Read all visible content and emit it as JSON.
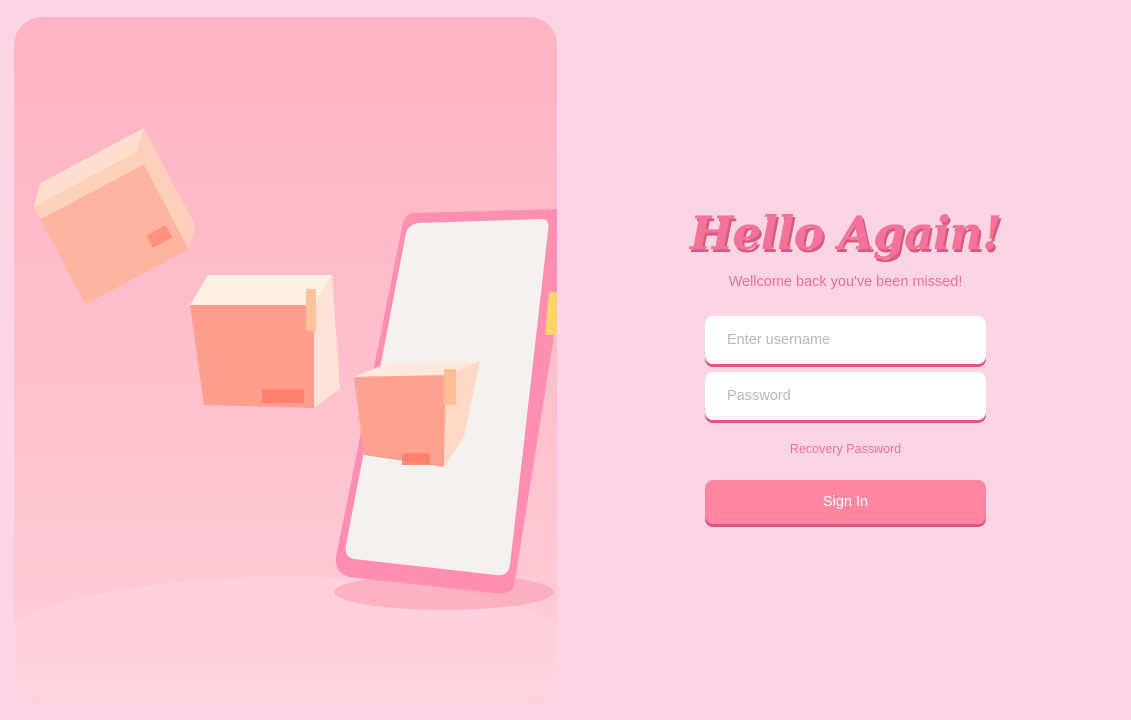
{
  "hero": {
    "illustration": "delivery-boxes-phone"
  },
  "login": {
    "title": "Hello Again!",
    "subtitle": "Wellcome back you've been missed!",
    "username_placeholder": "Enter username",
    "password_placeholder": "Password",
    "recovery_label": "Recovery Password",
    "signin_label": "Sign In"
  },
  "colors": {
    "background": "#fbd5e6",
    "accent": "#ff86a0",
    "accent_shadow": "#e0557d",
    "text_accent": "#f36f93"
  }
}
